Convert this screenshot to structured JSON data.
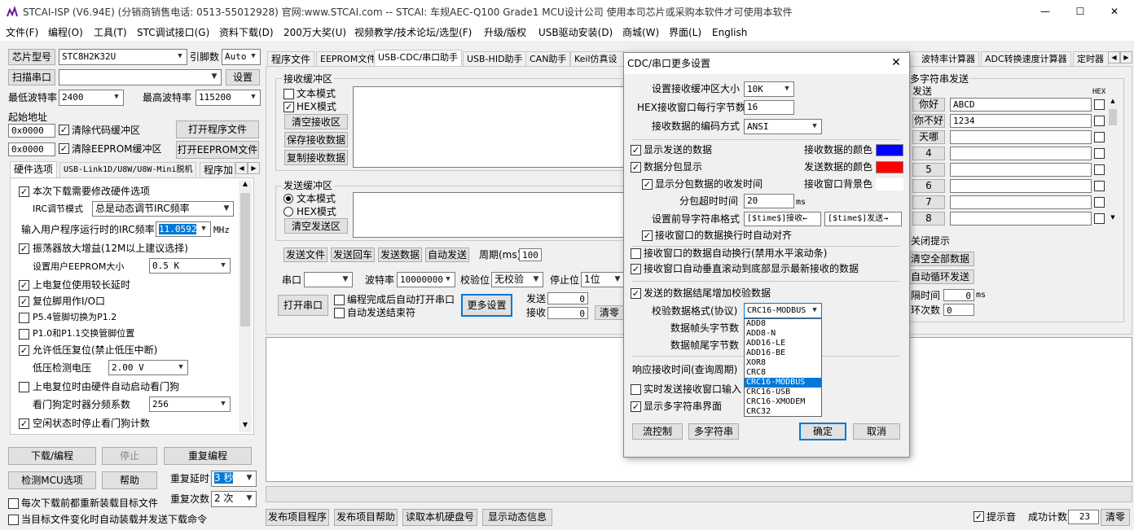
{
  "window": {
    "title": "STCAI-ISP (V6.94E) (分销商销售电话: 0513-55012928) 官网:www.STCAI.com  -- STCAI: 车规AEC-Q100 Grade1 MCU设计公司 使用本司芯片或采购本软件才可使用本软件",
    "minimize": "—",
    "maximize": "☐",
    "close": "✕"
  },
  "menu": [
    "文件(F)",
    "编程(O)",
    "工具(T)",
    "STC调试接口(G)",
    "资料下载(D)",
    "200万大奖(U)",
    "视频教学/技术论坛/选型(F)",
    "升级/版权",
    "USB驱动安装(D)",
    "商城(W)",
    "界面(L)",
    "English"
  ],
  "left": {
    "chip_label": "芯片型号",
    "chip_value": "STC8H2K32U",
    "pins_label": "引脚数",
    "pins_value": "Auto",
    "scan_button": "扫描串口",
    "settings_button": "设置",
    "min_baud_label": "最低波特率",
    "min_baud_value": "2400",
    "max_baud_label": "最高波特率",
    "max_baud_value": "115200",
    "start_addr_label": "起始地址",
    "addr1": "0x0000",
    "clear_code": "清除代码缓冲区",
    "open_prog": "打开程序文件",
    "addr2": "0x0000",
    "clear_eeprom": "清除EEPROM缓冲区",
    "open_eeprom": "打开EEPROM文件",
    "tabs": [
      "硬件选项",
      "USB-Link1D/U8W/U8W-Mini脱机",
      "程序加"
    ],
    "hw": {
      "opt1": "本次下载需要修改硬件选项",
      "irc_mode_label": "IRC调节模式",
      "irc_mode_value": "总是动态调节IRC频率",
      "irc_freq_label": "输入用户程序运行时的IRC频率",
      "irc_freq_value": "11.0592",
      "irc_unit": "MHz",
      "opt2": "振荡器放大增益(12M以上建议选择)",
      "eeprom_label": "设置用户EEPROM大小",
      "eeprom_value": "0.5 K",
      "opt3": "上电复位使用较长延时",
      "opt4": "复位脚用作I/O口",
      "opt5": "P5.4管脚切换为P1.2",
      "opt6": "P1.0和P1.1交换管脚位置",
      "opt7": "允许低压复位(禁止低压中断)",
      "lv_label": "低压检测电压",
      "lv_value": "2.00 V",
      "opt8": "上电复位时由硬件自动启动看门狗",
      "wdt_label": "看门狗定时器分频系数",
      "wdt_value": "256",
      "opt9": "空闲状态时停止看门狗计数"
    },
    "download_btn": "下载/编程",
    "stop_btn": "停止",
    "reprog_btn": "重复编程",
    "detect_btn": "检测MCU选项",
    "help_btn": "帮助",
    "delay_label": "重复延时",
    "delay_value": "3 秒",
    "count_label": "重复次数",
    "count_value": "2 次",
    "reload_opt": "每次下载前都重新装载目标文件",
    "auto_opt": "当目标文件变化时自动装载并发送下载命令"
  },
  "tabs_right": [
    "程序文件",
    "EEPROM文件",
    "USB-CDC/串口助手",
    "USB-HID助手",
    "CAN助手",
    "Keil仿真设",
    "波特率计算器",
    "ADC转换速度计算器",
    "定时器"
  ],
  "serial": {
    "recv_group": "接收缓冲区",
    "text_mode": "文本模式",
    "hex_mode": "HEX模式",
    "clear_recv": "清空接收区",
    "save_recv": "保存接收数据",
    "copy_recv": "复制接收数据",
    "send_group": "发送缓冲区",
    "send_text": "文本模式",
    "send_hex": "HEX模式",
    "clear_send": "清空发送区",
    "send_file": "发送文件",
    "send_cr": "发送回车",
    "send_data": "发送数据",
    "auto_send": "自动发送",
    "period_label": "周期(ms)",
    "period_value": "100",
    "port_label": "串口",
    "baud_label": "波特率",
    "baud_value": "10000000",
    "parity_label": "校验位",
    "parity_value": "无校验",
    "stop_label": "停止位",
    "stop_value": "1位",
    "open_port": "打开串口",
    "auto_open": "编程完成后自动打开串口",
    "auto_end": "自动发送结束符",
    "more_settings": "更多设置",
    "sent_label": "发送",
    "sent_value": "0",
    "recv_label": "接收",
    "recv_value": "0",
    "clear_count": "清零"
  },
  "multi": {
    "group": "多字符串发送",
    "send_col": "发送",
    "hex_col": "HEX",
    "rows": [
      {
        "btn": "你好",
        "text": "ABCD"
      },
      {
        "btn": "你不好",
        "text": "1234"
      },
      {
        "btn": "天哪",
        "text": ""
      },
      {
        "btn": "4",
        "text": ""
      },
      {
        "btn": "5",
        "text": ""
      },
      {
        "btn": "6",
        "text": ""
      },
      {
        "btn": "7",
        "text": ""
      },
      {
        "btn": "8",
        "text": ""
      }
    ],
    "close_tip": "关闭提示",
    "clear_all": "清空全部数据",
    "auto_loop": "自动循环发送",
    "interval_label": "隔时间",
    "interval_value": "0",
    "interval_unit": "ms",
    "loop_label": "环次数",
    "loop_value": "0"
  },
  "bottom": {
    "publish_prog": "发布项目程序",
    "publish_help": "发布项目帮助",
    "read_disk": "读取本机硬盘号",
    "show_dyn": "显示动态信息",
    "beep": "提示音",
    "success_label": "成功计数",
    "success_value": "23",
    "clear": "清零"
  },
  "dialog": {
    "title": "CDC/串口更多设置",
    "close": "✕",
    "buf_label": "设置接收缓冲区大小",
    "buf_value": "10K",
    "hex_bytes_label": "HEX接收窗口每行字节数",
    "hex_bytes_value": "16",
    "encoding_label": "接收数据的编码方式",
    "encoding_value": "ANSI",
    "show_sent": "显示发送的数据",
    "recv_color_label": "接收数据的颜色",
    "recv_color": "#0000ff",
    "packet_show": "数据分包显示",
    "send_color_label": "发送数据的颜色",
    "send_color": "#ff0000",
    "show_packet_time": "显示分包数据的收发时间",
    "bg_color_label": "接收窗口背景色",
    "bg_color": "#ffffff",
    "timeout_label": "分包超时时间",
    "timeout_value": "20",
    "timeout_unit": "ms",
    "prefix_label": "设置前导字符串格式",
    "prefix_recv": "[$time$]接收←",
    "prefix_send": "[$time$]发送→",
    "auto_align": "接收窗口的数据换行时自动对齐",
    "auto_wrap": "接收窗口的数据自动换行(禁用水平滚动条)",
    "auto_scroll": "接收窗口自动垂直滚动到底部显示最新接收的数据",
    "checksum": "发送的数据结尾增加校验数据",
    "checksum_fmt_label": "校验数据格式(协议)",
    "checksum_fmt_value": "CRC16-MODBUS",
    "frame_head_label": "数据帧头字节数",
    "frame_tail_label": "数据帧尾字节数",
    "response_label": "响应接收时间(查询周期)",
    "realtime": "实时发送接收窗口输入",
    "show_multi": "显示多字符串界面",
    "flow_btn": "流控制",
    "multi_btn": "多字符串",
    "ok_btn": "确定",
    "cancel_btn": "取消",
    "dropdown": [
      "ADD8",
      "ADD8-N",
      "ADD16-LE",
      "ADD16-BE",
      "XOR8",
      "CRC8",
      "CRC16-MODBUS",
      "CRC16-USB",
      "CRC16-XMODEM",
      "CRC32"
    ],
    "dropdown_selected": "CRC16-MODBUS"
  }
}
